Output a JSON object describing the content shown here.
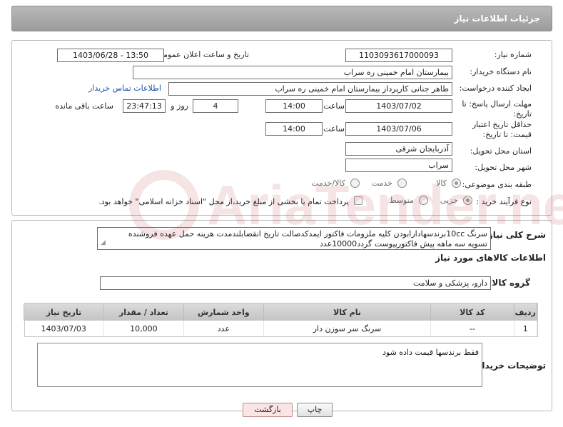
{
  "page": {
    "title": "جزئیات اطلاعات نیاز"
  },
  "fields": {
    "need_number_label": "شماره نیاز:",
    "need_number": "1103093617000093",
    "announce_label": "تاریخ و ساعت اعلان عمومی:",
    "announce_value": "1403/06/28 - 13:50",
    "buyer_org_label": "نام دستگاه خریدار:",
    "buyer_org": "بیمارستان امام خمینی ره  سراب",
    "creator_label": "ایجاد کننده درخواست:",
    "creator": "طاهر جنانی کارپرداز بیمارستان امام خمینی ره  سراب",
    "contact_link": "اطلاعات تماس خریدار",
    "reply_deadline_label": "مهلت ارسال پاسخ: تا تاریخ:",
    "reply_date": "1403/07/02",
    "reply_time_label": "ساعت",
    "reply_time": "14:00",
    "days_value": "4",
    "days_and_label": "روز و",
    "remaining_time": "23:47:13",
    "remaining_label": "ساعت باقی مانده",
    "price_validity_label": "حداقل تاریخ اعتبار قیمت: تا تاریخ:",
    "price_date": "1403/07/06",
    "price_time_label": "ساعت",
    "price_time": "14:00",
    "province_label": "استان محل تحویل:",
    "province": "آذربایجان شرقی",
    "city_label": "شهر محل تحویل:",
    "city": "سراب",
    "category_label": "طبقه بندی موضوعی:",
    "category_options": [
      "کالا",
      "خدمت",
      "کالا/خدمت"
    ],
    "process_label": "نوع فرآیند خرید :",
    "process_options": [
      "جزیی",
      "متوسط"
    ],
    "payment_note": "پرداخت تمام یا بخشی از مبلغ خرید،از محل \"اسناد خزانه اسلامی\" خواهد بود."
  },
  "description": {
    "label": "شرح کلی نیاز:",
    "text_line1": "سرنگ 10ccبرندسهادارابودن کلیه ملزومات فاکتور ایمدکدصالت تاریخ انقضابلندمدت هزینه حمل عهده فروشنده",
    "text_line2": "تسویه سه ماهه پیش فاکتورپیوست گردد10000عدد"
  },
  "goods_section": {
    "title": "اطلاعات کالاهای مورد نیاز",
    "group_label": "گروه کالا:",
    "group_value": "دارو، پزشکی و سلامت"
  },
  "table": {
    "headers": [
      "ردیف",
      "کد کالا",
      "نام کالا",
      "واحد شمارش",
      "تعداد / مقدار",
      "تاریخ نیاز"
    ],
    "rows": [
      {
        "row": "1",
        "code": "--",
        "name": "سرنگ سر سوزن دار",
        "unit": "عدد",
        "qty": "10,000",
        "date": "1403/07/03"
      }
    ]
  },
  "buyer_notes": {
    "label": "توضیحات خریدار:",
    "text": "فقط برندسها قیمت داده شود"
  },
  "buttons": {
    "print": "چاپ",
    "back": "بازگشت"
  },
  "watermark": {
    "text": "AriaTender.neT"
  },
  "colors": {
    "header_bg": "#a9a9a9",
    "link": "#1f4fa8",
    "back_button_bg": "#fbe4e4"
  }
}
